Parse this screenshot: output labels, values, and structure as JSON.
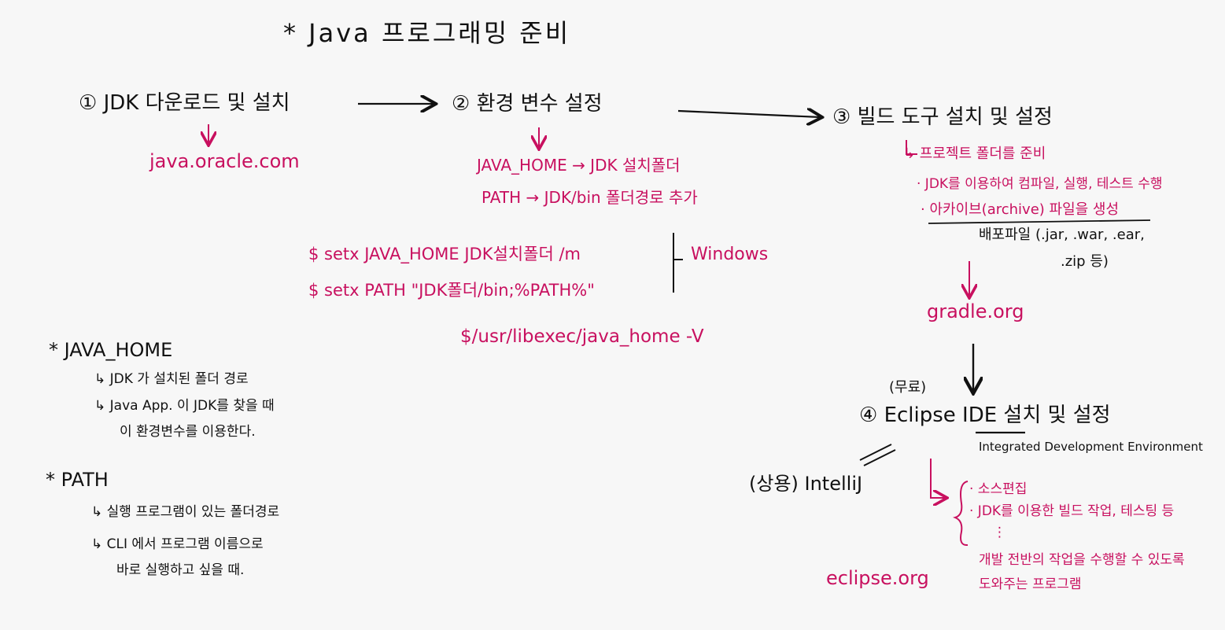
{
  "colors": {
    "ink": "#111111",
    "accent": "#c8105f",
    "paper": "#f7f7f7"
  },
  "title": "* Java 프로그래밍 준비",
  "steps": {
    "s1": "① JDK 다운로드 및 설치",
    "s1_link": "java.oracle.com",
    "s2": "② 환경 변수 설정",
    "s2_java_home": "JAVA_HOME → JDK 설치폴더",
    "s2_path": "PATH → JDK/bin 폴더경로 추가",
    "s3": "③ 빌드 도구 설치 및 설정",
    "s3_sub1": "↳ 프로젝트 폴더를 준비",
    "s3_sub2": "· JDK를 이용하여 컴파일, 실행, 테스트 수행",
    "s3_sub3": "· 아카이브(archive) 파일을 생성",
    "s3_sub4": "배포파일 (.jar, .war, .ear,",
    "s3_sub5": ".zip 등)",
    "s3_link": "gradle.org",
    "s4_free": "(무료)",
    "s4": "④ Eclipse IDE 설치 및 설정",
    "s4_ide": "Integrated Development Environment",
    "s4_commercial": "(상용) IntelliJ",
    "s4_link": "eclipse.org",
    "s4_b1": "· 소스편집",
    "s4_b2": "· JDK를 이용한 빌드 작업, 테스팅 등",
    "s4_b3": "⋮",
    "s4_b4": "개발 전반의 작업을 수행할 수 있도록",
    "s4_b5": "도와주는 프로그램"
  },
  "commands": {
    "c1": "$ setx JAVA_HOME JDK설치폴더 /m",
    "c2": "$ setx PATH \"JDK폴더/bin;%PATH%\"",
    "windows": "Windows",
    "c3": "$/usr/libexec/java_home -V"
  },
  "notes": {
    "jh_title": "* JAVA_HOME",
    "jh_1": "↳ JDK 가 설치된 폴더 경로",
    "jh_2": "↳ Java App. 이 JDK를 찾을 때",
    "jh_3": "이 환경변수를 이용한다.",
    "path_title": "* PATH",
    "path_1": "↳ 실행 프로그램이 있는 폴더경로",
    "path_2": "↳ CLI 에서 프로그램 이름으로",
    "path_3": "바로 실행하고 싶을 때."
  }
}
